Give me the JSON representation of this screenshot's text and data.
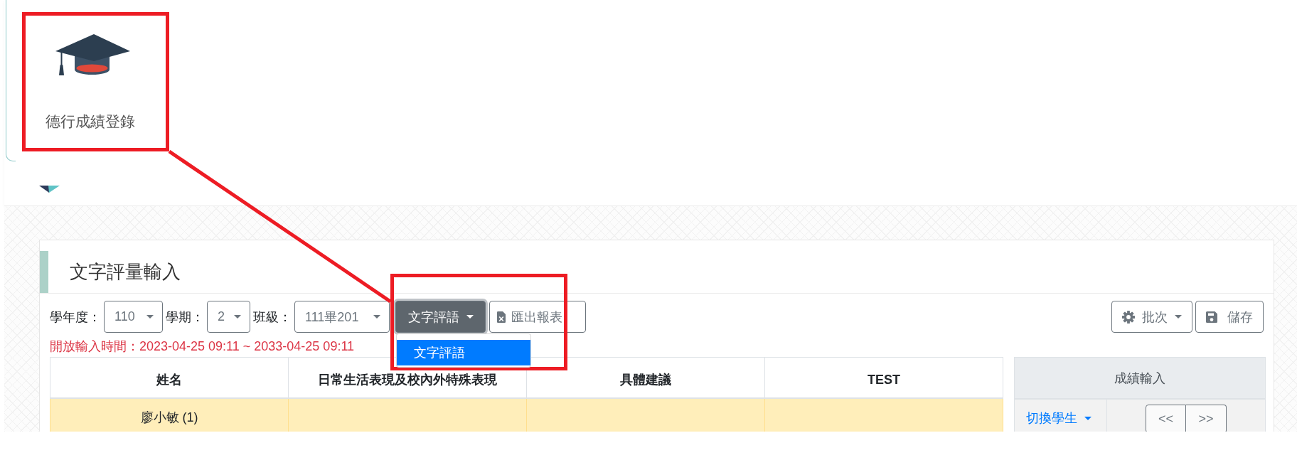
{
  "app_tile": {
    "label": "德行成績登錄"
  },
  "panel": {
    "title": "文字評量輸入"
  },
  "toolbar": {
    "filters": [
      {
        "label": "學年度：",
        "value": "110"
      },
      {
        "label": "學期：",
        "value": "2"
      },
      {
        "label": "班級：",
        "value": "111畢201"
      }
    ],
    "view_menu": {
      "label": "文字評語",
      "expanded": true,
      "items": [
        {
          "label": "文字評語",
          "selected": true
        }
      ]
    },
    "export_button": {
      "label": "匯出報表"
    },
    "batch_button": {
      "label": "批次"
    },
    "save_button": {
      "label": "儲存"
    }
  },
  "open_period": "開放輸入時間：2023-04-25 09:11 ~ 2033-04-25 09:11",
  "table": {
    "columns": [
      "姓名",
      "日常生活表現及校內外特殊表現",
      "具體建議",
      "TEST"
    ],
    "rows": [
      {
        "name": "廖小敏 (1)",
        "selected": true
      }
    ]
  },
  "score_panel": {
    "title": "成績輸入",
    "switch_student": "切換學生",
    "prev_button": "<<",
    "next_button": ">>"
  }
}
